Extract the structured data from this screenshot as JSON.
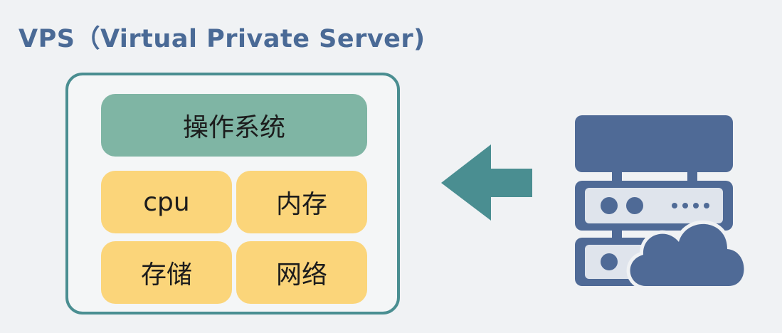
{
  "title": "VPS（Virtual Private Server)",
  "vps": {
    "os_label": "操作系统",
    "resources": [
      {
        "label": "cpu"
      },
      {
        "label": "内存"
      },
      {
        "label": "存储"
      },
      {
        "label": "网络"
      }
    ]
  },
  "icons": {
    "arrow": "arrow-left-icon",
    "server": "server-cloud-icon"
  },
  "colors": {
    "title": "#4a6a96",
    "frame": "#4a8e91",
    "os_block": "#7fb5a4",
    "resource_block": "#fbd57a",
    "arrow": "#4a8e91",
    "server": "#4f6a96",
    "background": "#f0f2f4"
  }
}
